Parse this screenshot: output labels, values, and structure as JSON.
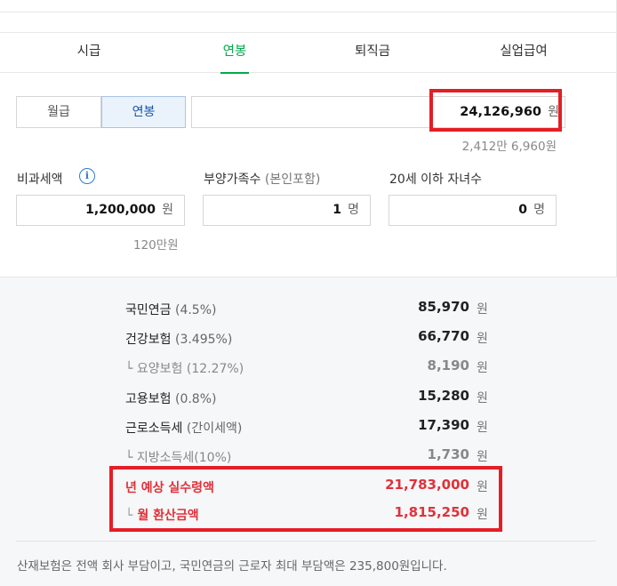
{
  "tabs": [
    {
      "label": "시급",
      "active": false
    },
    {
      "label": "연봉",
      "active": true
    },
    {
      "label": "퇴직금",
      "active": false
    },
    {
      "label": "실업급여",
      "active": false
    }
  ],
  "pay_type": {
    "monthly": "월급",
    "annual": "연봉",
    "selected": "연봉"
  },
  "salary": {
    "value": "24,126,960",
    "unit": "원",
    "korean": "2,412만 6,960원"
  },
  "nontax": {
    "label": "비과세액",
    "value": "1,200,000",
    "unit": "원",
    "korean": "120만원"
  },
  "dependents": {
    "label": "부양가족수",
    "note": "(본인포함)",
    "value": "1",
    "unit": "명"
  },
  "children": {
    "label": "20세 이하 자녀수",
    "value": "0",
    "unit": "명"
  },
  "results": [
    {
      "label": "국민연금",
      "pct": "(4.5%)",
      "value": "85,970",
      "unit": "원",
      "sub": false
    },
    {
      "label": "건강보험",
      "pct": "(3.495%)",
      "value": "66,770",
      "unit": "원",
      "sub": false
    },
    {
      "label": "요양보험",
      "pct": "(12.27%)",
      "value": "8,190",
      "unit": "원",
      "sub": true
    },
    {
      "label": "고용보험",
      "pct": "(0.8%)",
      "value": "15,280",
      "unit": "원",
      "sub": false
    },
    {
      "label": "근로소득세",
      "pct": "(간이세액)",
      "value": "17,390",
      "unit": "원",
      "sub": false
    },
    {
      "label": "지방소득세",
      "pct": "(10%)",
      "value": "1,730",
      "unit": "원",
      "sub": true
    }
  ],
  "annual_net": {
    "label": "년 예상 실수령액",
    "value": "21,783,000",
    "unit": "원"
  },
  "monthly_net": {
    "label": "월 환산금액",
    "value": "1,815,250",
    "unit": "원"
  },
  "footnote": "산재보험은 전액 회사 부담이고, 국민연금의 근로자 최대 부담액은 235,800원입니다.",
  "colors": {
    "accent_green": "#03a94d",
    "highlight_red": "#e41e26",
    "result_red": "#e0313a",
    "selected_blue": "#1a52a8"
  },
  "icons": {
    "info": "info-icon",
    "sub_branch": "└"
  }
}
